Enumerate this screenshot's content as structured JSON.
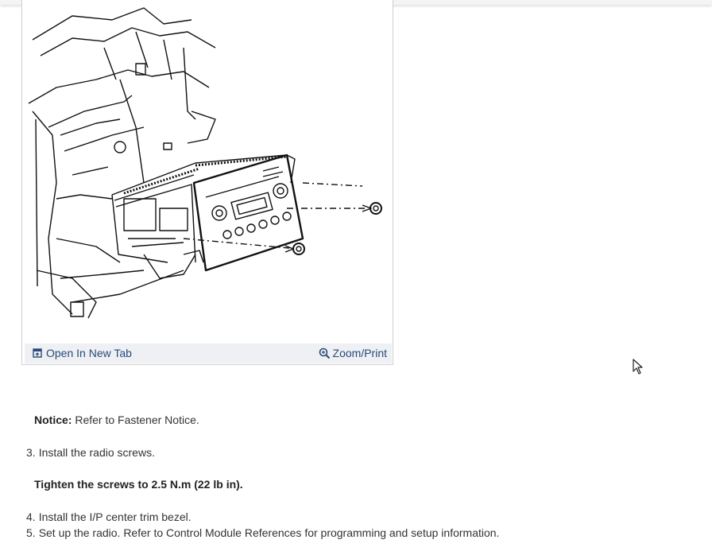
{
  "figure": {
    "open_tab_label": "Open In New Tab",
    "zoom_label": "Zoom/Print"
  },
  "content": {
    "notice_label": "Notice:",
    "notice_text": "Refer to Fastener Notice.",
    "steps": [
      {
        "num": "3.",
        "text": "Install the radio screws."
      },
      {
        "num": "4.",
        "text": "Install the I/P center trim bezel."
      },
      {
        "num": "5.",
        "text": "Set up the radio. Refer to Control Module References for programming and setup information."
      }
    ],
    "tighten_text": "Tighten the screws to 2.5 N.m (22 lb in)."
  },
  "colors": {
    "link": "#2a4a7c",
    "toolbar_bg": "#eef0f3",
    "text": "#333333"
  },
  "icons": [
    "open-new-tab-icon",
    "zoom-icon",
    "mouse-pointer-icon"
  ]
}
